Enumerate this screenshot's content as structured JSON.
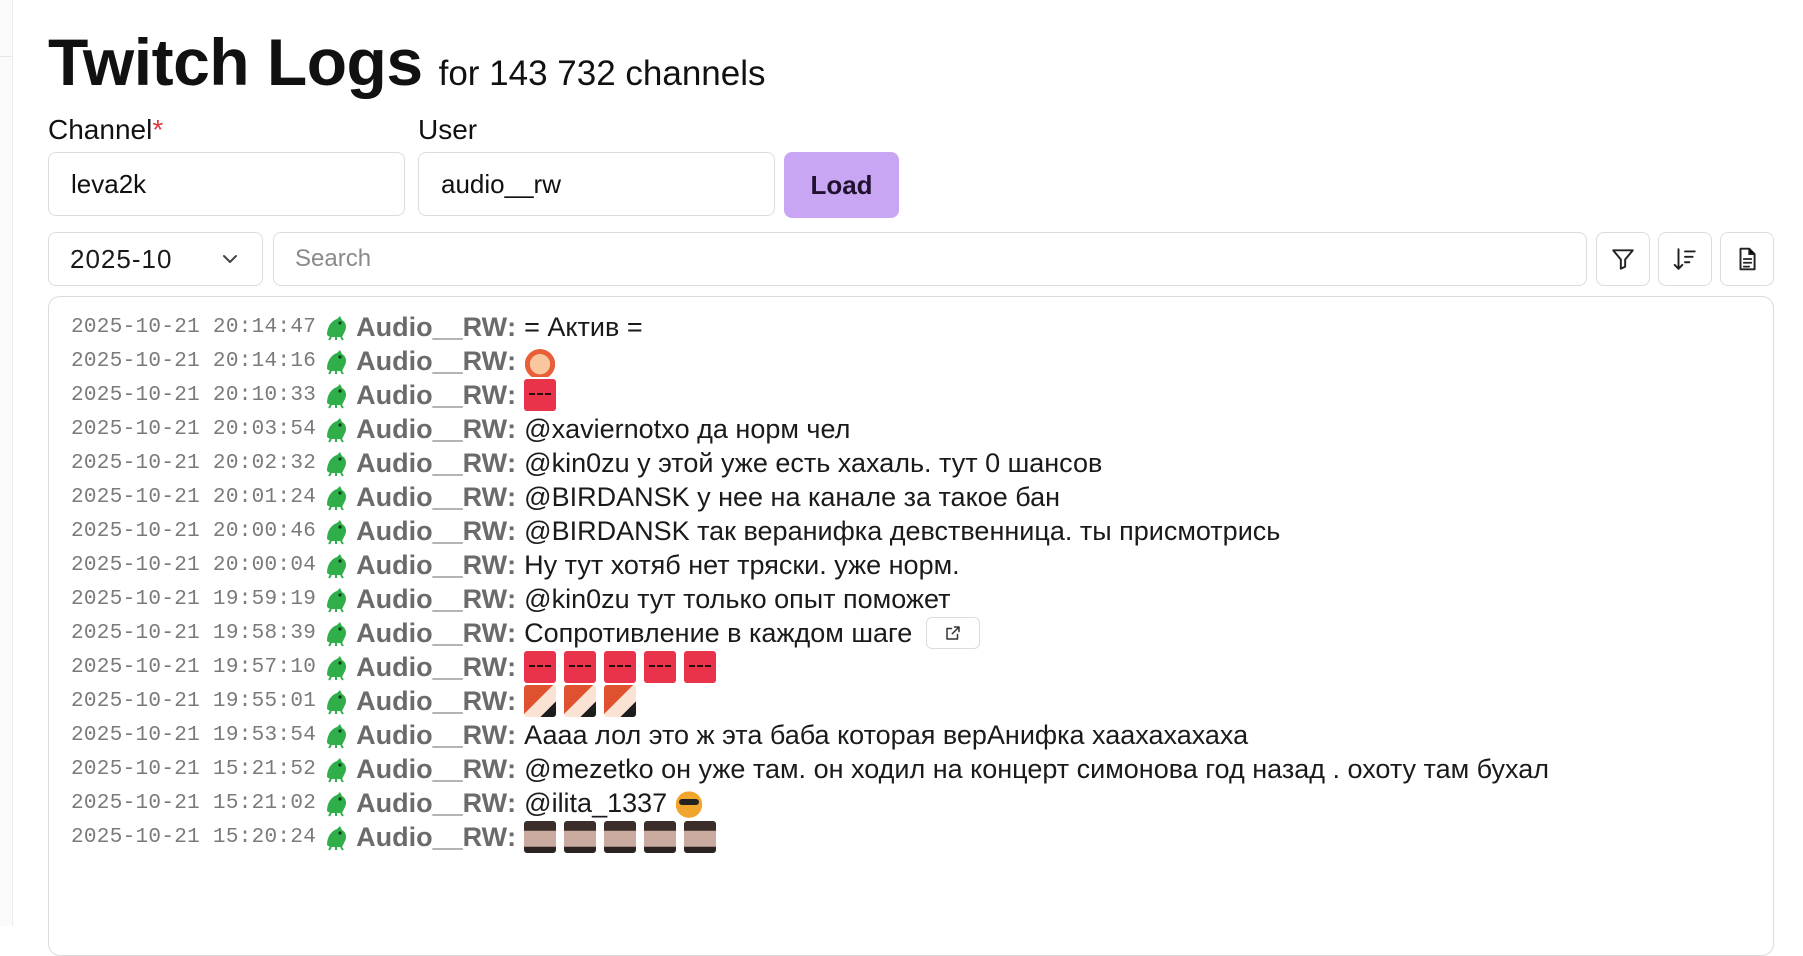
{
  "header": {
    "title": "Twitch Logs",
    "subtitle": "for 143 732 channels"
  },
  "form": {
    "channel_label": "Channel",
    "required_mark": "*",
    "channel_value": "leva2k",
    "user_label": "User",
    "user_value": "audio__rw",
    "load_label": "Load"
  },
  "toolbar": {
    "month_value": "2025-10",
    "search_placeholder": "Search",
    "icons": [
      "chevron-down-icon",
      "filter-icon",
      "sort-descending-icon",
      "document-icon"
    ]
  },
  "colors": {
    "accent": "#c9a6f3",
    "required": "#e0383e",
    "username": "#6b6b6b",
    "timestamp": "#7a7a7a",
    "border": "#dcdcdc"
  },
  "logs": {
    "username": "Audio__RW",
    "colon": ":",
    "entries": [
      {
        "ts": "2025-10-21 20:14:47",
        "text": "= Актив ="
      },
      {
        "ts": "2025-10-21 20:14:16",
        "text": "",
        "emotes": [
          "cute"
        ]
      },
      {
        "ts": "2025-10-21 20:10:33",
        "text": "",
        "emotes": [
          "red"
        ]
      },
      {
        "ts": "2025-10-21 20:03:54",
        "text": "@xaviernotxo да норм чел"
      },
      {
        "ts": "2025-10-21 20:02:32",
        "text": "@kin0zu у этой уже есть хахаль. тут 0 шансов"
      },
      {
        "ts": "2025-10-21 20:01:24",
        "text": "@BIRDANSK у нее на канале за такое бан"
      },
      {
        "ts": "2025-10-21 20:00:46",
        "text": "@BIRDANSK так веранифка девственница. ты присмотрись"
      },
      {
        "ts": "2025-10-21 20:00:04",
        "text": "Ну тут хотяб нет тряски. уже норм."
      },
      {
        "ts": "2025-10-21 19:59:19",
        "text": "@kin0zu тут только опыт поможет"
      },
      {
        "ts": "2025-10-21 19:58:39",
        "text": "Сопротивление в каждом шаге",
        "link": true
      },
      {
        "ts": "2025-10-21 19:57:10",
        "text": "",
        "emotes": [
          "red",
          "red",
          "red",
          "red",
          "red"
        ]
      },
      {
        "ts": "2025-10-21 19:55:01",
        "text": "",
        "emotes": [
          "ginger",
          "ginger",
          "ginger"
        ]
      },
      {
        "ts": "2025-10-21 19:53:54",
        "text": "Аааа лол это ж эта баба которая верАнифка хаахахахаха"
      },
      {
        "ts": "2025-10-21 15:21:52",
        "text": "@mezetko он уже там. он ходил на концерт симонова год назад . охоту там бухал"
      },
      {
        "ts": "2025-10-21 15:21:02",
        "text": "@ilita_1337",
        "emotes_after": [
          "cat"
        ]
      },
      {
        "ts": "2025-10-21 15:20:24",
        "text": "",
        "emotes": [
          "face",
          "face",
          "face",
          "face",
          "face"
        ]
      }
    ]
  }
}
